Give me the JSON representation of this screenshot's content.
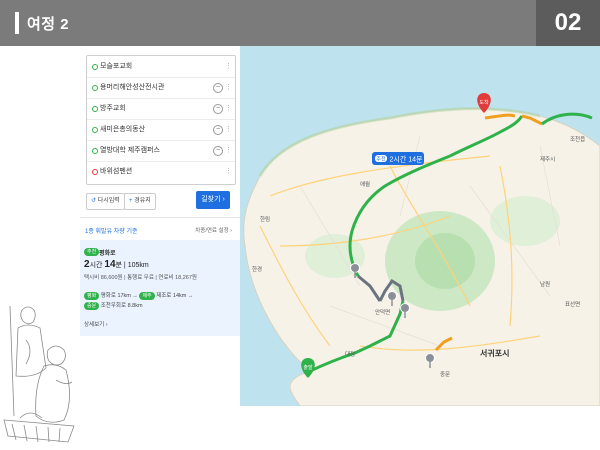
{
  "slide": {
    "title": "여정 2",
    "page": "02"
  },
  "panel": {
    "waypoints": [
      {
        "label": "모슬포교회",
        "removable": false,
        "dot": "green"
      },
      {
        "label": "용머리해안성산전시관",
        "removable": true,
        "dot": "green"
      },
      {
        "label": "방주교회",
        "removable": true,
        "dot": "green"
      },
      {
        "label": "새미은총의동산",
        "removable": true,
        "dot": "green"
      },
      {
        "label": "열방대학 제주캠퍼스",
        "removable": true,
        "dot": "green"
      },
      {
        "label": "바위섬펜션",
        "removable": false,
        "dot": "red"
      }
    ],
    "reset_label": "다시입력",
    "via_label": "경유지",
    "search_label": "길찾기 ›",
    "filter_label": "1종 휘발유 차량 기준",
    "option_label": "차종/연료 설정 ›",
    "result": {
      "badge": "추천",
      "via": "평화로",
      "hours": "2",
      "hour_unit": "시간",
      "minutes": "14",
      "minute_unit": "분",
      "distance": "105km",
      "cost": "택시비 86,600원 | 통행료 무료 | 연료비 18,267원",
      "road1_badge": "평화",
      "road1_text": "평화로 17km →",
      "road1b_badge": "제주",
      "road1b_text": "제조로 14km →",
      "road2_badge": "중문",
      "road2_text": "조천우회로 8.8km",
      "detail": "상세보기 ›"
    }
  },
  "map": {
    "route_badge": "추천",
    "route_time": "2시간 14분",
    "start_label": "출발",
    "end_label": "도착",
    "city_label": "서귀포시",
    "route_color": "#2fb24a",
    "place_labels": [
      "제주시",
      "조천읍",
      "한림",
      "애월",
      "한경",
      "대정",
      "안덕면",
      "남원",
      "표선면",
      "중문"
    ]
  }
}
